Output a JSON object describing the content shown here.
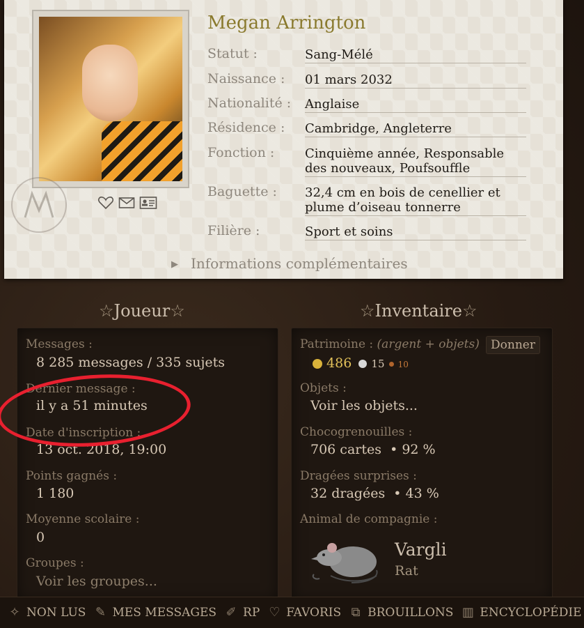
{
  "profile": {
    "name": "Megan Arrington",
    "rows": [
      {
        "label": "Statut :",
        "value": "Sang-Mélé"
      },
      {
        "label": "Naissance :",
        "value": "01 mars 2032"
      },
      {
        "label": "Nationalité :",
        "value": "Anglaise"
      },
      {
        "label": "Résidence :",
        "value": "Cambridge, Angleterre"
      },
      {
        "label": "Fonction :",
        "value": "Cinquième année, Responsable des nouveaux, Poufsouffle"
      },
      {
        "label": "Baguette :",
        "value": "32,4 cm en bois de cenellier et plume d’oiseau tonnerre"
      },
      {
        "label": "Filière :",
        "value": "Sport et soins"
      }
    ],
    "more_info": "Informations complémentaires",
    "icons": [
      "heart-icon",
      "mail-icon",
      "id-card-icon"
    ]
  },
  "joueur": {
    "title": "Joueur",
    "messages_label": "Messages :",
    "messages_value": "8 285 messages / 335 sujets",
    "last_label": "Dernier message :",
    "last_value": "il y a 51 minutes",
    "date_label": "Date d'inscription :",
    "date_value": "13 oct. 2018, 19:00",
    "points_label": "Points gagnés :",
    "points_value": "1 180",
    "moyenne_label": "Moyenne scolaire :",
    "moyenne_value": "0",
    "groupes_label": "Groupes :",
    "groupes_value": "Voir les groupes..."
  },
  "inventaire": {
    "title": "Inventaire",
    "patrimoine_label": "Patrimoine :",
    "patrimoine_note": "(argent + objets)",
    "give_button": "Donner",
    "gold": "486",
    "silver": "15",
    "bronze": "10",
    "objets_label": "Objets :",
    "objets_value": "Voir les objets...",
    "choco_label": "Chocogrenouilles :",
    "choco_value": "706 cartes",
    "choco_pct": "• 92 %",
    "dragees_label": "Dragées surprises :",
    "dragees_value": "32 dragées",
    "dragees_pct": "• 43 %",
    "animal_label": "Animal de compagnie :",
    "animal_name": "Vargli",
    "animal_type": "Rat"
  },
  "nav": [
    {
      "label": "NON LUS",
      "icon": "sparkle-icon"
    },
    {
      "label": "MES MESSAGES",
      "icon": "quill-icon"
    },
    {
      "label": "RP",
      "icon": "feather-icon"
    },
    {
      "label": "FAVORIS",
      "icon": "heart-icon"
    },
    {
      "label": "BROUILLONS",
      "icon": "drafts-icon"
    },
    {
      "label": "ENCYCLOPÉDIE",
      "icon": "books-icon"
    }
  ],
  "colors": {
    "accent_name": "#8a7a2e",
    "annotation_red": "#e8202f",
    "gold_coin": "#d9b23a",
    "silver_coin": "#d8d8d8",
    "bronze_coin": "#b0642c"
  }
}
